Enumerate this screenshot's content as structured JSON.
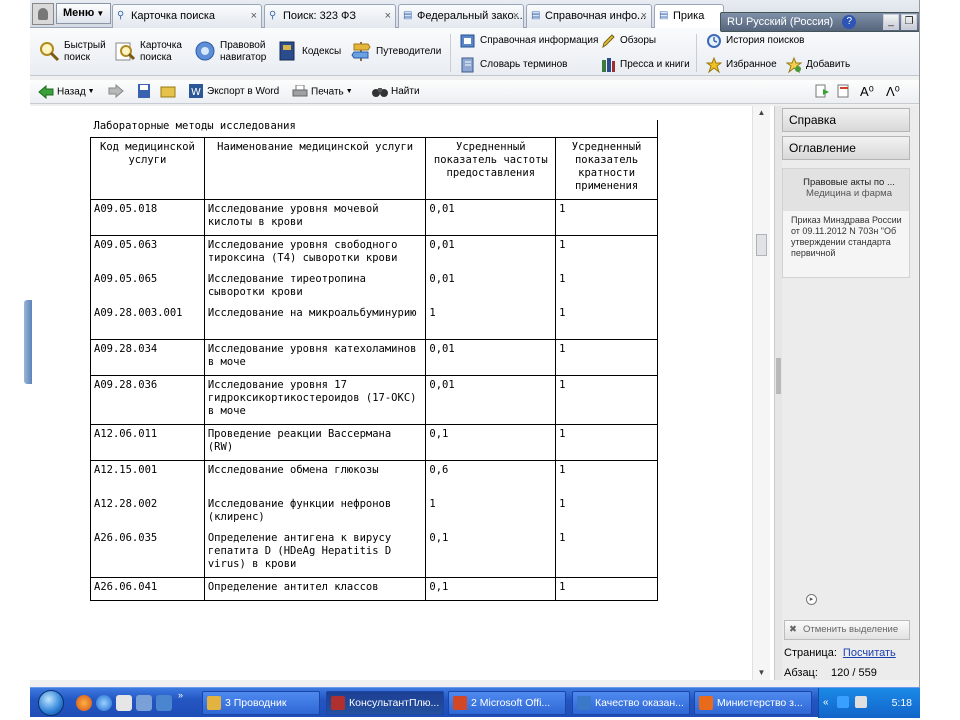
{
  "app": {
    "menu_label": "Меню",
    "tabs": [
      {
        "label": "Карточка поиска",
        "icon": "search-icon",
        "active": false
      },
      {
        "label": "Поиск: 323 ФЗ",
        "icon": "search-icon",
        "active": false
      },
      {
        "label": "Федеральный зако...",
        "icon": "document-icon",
        "active": false
      },
      {
        "label": "Справочная инфо...",
        "icon": "document-icon",
        "active": false
      },
      {
        "label": "Прика",
        "icon": "document-icon",
        "active": true
      }
    ],
    "language": "RU Русский (Россия)",
    "help_glyph": "?"
  },
  "toolbar": {
    "quick_search": "Быстрый поиск",
    "search_card": "Карточка поиска",
    "legal_navigator": "Правовой навигатор",
    "codes": "Кодексы",
    "guides": "Путеводители",
    "reference_info": "Справочная информация",
    "glossary": "Словарь терминов",
    "reviews": "Обзоры",
    "press_books": "Пресса и книги",
    "search_history": "История поисков",
    "favorites": "Избранное",
    "add": "Добавить"
  },
  "navbar": {
    "back": "Назад",
    "export_word": "Экспорт в Word",
    "print": "Печать",
    "find": "Найти"
  },
  "document": {
    "caption": "Лабораторные методы исследования",
    "headers": [
      "Код медицинской услуги",
      "Наименование медицинской услуги",
      "Усредненный показатель частоты предоставления",
      "Усредненный показатель кратности применения"
    ],
    "rows": [
      {
        "group": [
          [
            "A09.05.018",
            "Исследование уровня мочевой кислоты в крови",
            "0,01",
            "1"
          ]
        ]
      },
      {
        "group": [
          [
            "A09.05.063",
            "Исследование уровня свободного тироксина (Т4) сыворотки крови",
            "0,01",
            "1"
          ],
          [
            "A09.05.065",
            "Исследование тиреотропина сыворотки крови",
            "0,01",
            "1"
          ],
          [
            "A09.28.003.001",
            "Исследование на микроальбуминурию",
            "1",
            "1"
          ]
        ]
      },
      {
        "group": [
          [
            "A09.28.034",
            "Исследование уровня катехоламинов в моче",
            "0,01",
            "1"
          ]
        ]
      },
      {
        "group": [
          [
            "A09.28.036",
            "Исследование уровня 17 гидроксикортикостероидов (17-ОКС) в моче",
            "0,01",
            "1"
          ]
        ]
      },
      {
        "group": [
          [
            "A12.06.011",
            "Проведение реакции Вассермана (RW)",
            "0,1",
            "1"
          ]
        ]
      },
      {
        "group": [
          [
            "A12.15.001",
            "Исследование обмена глюкозы",
            "0,6",
            "1"
          ],
          [
            "A12.28.002",
            "Исследование функции нефронов (клиренс)",
            "1",
            "1"
          ],
          [
            "A26.06.035",
            "Определение антигена к вирусу гепатита D (HDeAg Hepatitis D virus) в крови",
            "0,1",
            "1"
          ]
        ]
      },
      {
        "group": [
          [
            "A26.06.041",
            "Определение антител классов",
            "0,1",
            "1"
          ]
        ]
      }
    ]
  },
  "right_panel": {
    "help": "Справка",
    "contents": "Оглавление",
    "box_title": "Правовые акты по ...",
    "box_subtitle": "Медицина и фарма",
    "box_text": "Приказ Минздрава России от 09.11.2012 N 703н \"Об утверждении стандарта первичной",
    "clear_selection": "Отменить выделение",
    "page_label": "Страница:",
    "page_link": "Посчитать",
    "paragraph_label": "Абзац:",
    "paragraph_value": "120 / 559"
  },
  "taskbar": {
    "tasks": [
      {
        "label": "3 Проводник",
        "active": false,
        "color": "#e3b341"
      },
      {
        "label": "КонсультантПлю...",
        "active": true,
        "color": "#b03030"
      },
      {
        "label": "2 Microsoft Offi...",
        "active": false,
        "color": "#d24726"
      },
      {
        "label": "Качество оказан...",
        "active": false,
        "color": "#3a78c8"
      },
      {
        "label": "Министерство з...",
        "active": false,
        "color": "#e86a1a"
      }
    ],
    "time": "5:18"
  }
}
